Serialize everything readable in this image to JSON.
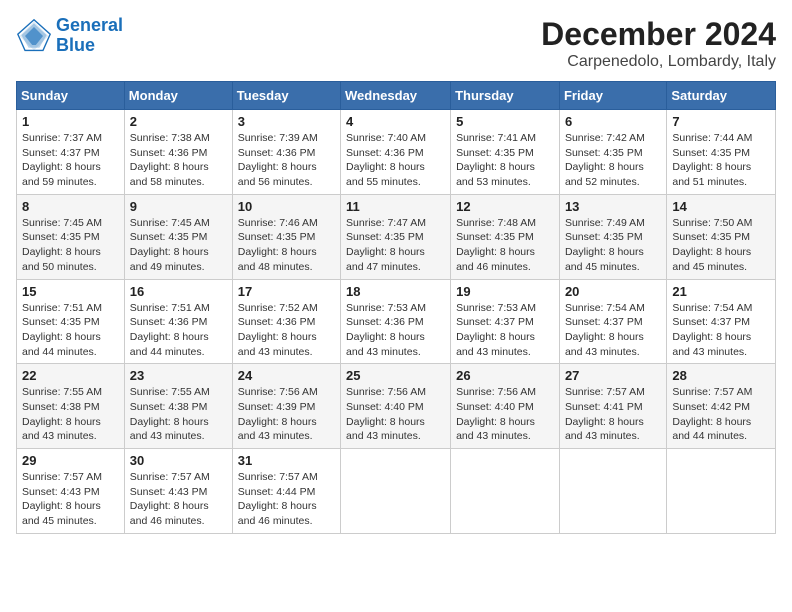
{
  "logo": {
    "line1": "General",
    "line2": "Blue"
  },
  "title": "December 2024",
  "location": "Carpenedolo, Lombardy, Italy",
  "weekdays": [
    "Sunday",
    "Monday",
    "Tuesday",
    "Wednesday",
    "Thursday",
    "Friday",
    "Saturday"
  ],
  "weeks": [
    [
      {
        "day": "1",
        "sunrise": "7:37 AM",
        "sunset": "4:37 PM",
        "daylight": "8 hours and 59 minutes."
      },
      {
        "day": "2",
        "sunrise": "7:38 AM",
        "sunset": "4:36 PM",
        "daylight": "8 hours and 58 minutes."
      },
      {
        "day": "3",
        "sunrise": "7:39 AM",
        "sunset": "4:36 PM",
        "daylight": "8 hours and 56 minutes."
      },
      {
        "day": "4",
        "sunrise": "7:40 AM",
        "sunset": "4:36 PM",
        "daylight": "8 hours and 55 minutes."
      },
      {
        "day": "5",
        "sunrise": "7:41 AM",
        "sunset": "4:35 PM",
        "daylight": "8 hours and 53 minutes."
      },
      {
        "day": "6",
        "sunrise": "7:42 AM",
        "sunset": "4:35 PM",
        "daylight": "8 hours and 52 minutes."
      },
      {
        "day": "7",
        "sunrise": "7:44 AM",
        "sunset": "4:35 PM",
        "daylight": "8 hours and 51 minutes."
      }
    ],
    [
      {
        "day": "8",
        "sunrise": "7:45 AM",
        "sunset": "4:35 PM",
        "daylight": "8 hours and 50 minutes."
      },
      {
        "day": "9",
        "sunrise": "7:45 AM",
        "sunset": "4:35 PM",
        "daylight": "8 hours and 49 minutes."
      },
      {
        "day": "10",
        "sunrise": "7:46 AM",
        "sunset": "4:35 PM",
        "daylight": "8 hours and 48 minutes."
      },
      {
        "day": "11",
        "sunrise": "7:47 AM",
        "sunset": "4:35 PM",
        "daylight": "8 hours and 47 minutes."
      },
      {
        "day": "12",
        "sunrise": "7:48 AM",
        "sunset": "4:35 PM",
        "daylight": "8 hours and 46 minutes."
      },
      {
        "day": "13",
        "sunrise": "7:49 AM",
        "sunset": "4:35 PM",
        "daylight": "8 hours and 45 minutes."
      },
      {
        "day": "14",
        "sunrise": "7:50 AM",
        "sunset": "4:35 PM",
        "daylight": "8 hours and 45 minutes."
      }
    ],
    [
      {
        "day": "15",
        "sunrise": "7:51 AM",
        "sunset": "4:35 PM",
        "daylight": "8 hours and 44 minutes."
      },
      {
        "day": "16",
        "sunrise": "7:51 AM",
        "sunset": "4:36 PM",
        "daylight": "8 hours and 44 minutes."
      },
      {
        "day": "17",
        "sunrise": "7:52 AM",
        "sunset": "4:36 PM",
        "daylight": "8 hours and 43 minutes."
      },
      {
        "day": "18",
        "sunrise": "7:53 AM",
        "sunset": "4:36 PM",
        "daylight": "8 hours and 43 minutes."
      },
      {
        "day": "19",
        "sunrise": "7:53 AM",
        "sunset": "4:37 PM",
        "daylight": "8 hours and 43 minutes."
      },
      {
        "day": "20",
        "sunrise": "7:54 AM",
        "sunset": "4:37 PM",
        "daylight": "8 hours and 43 minutes."
      },
      {
        "day": "21",
        "sunrise": "7:54 AM",
        "sunset": "4:37 PM",
        "daylight": "8 hours and 43 minutes."
      }
    ],
    [
      {
        "day": "22",
        "sunrise": "7:55 AM",
        "sunset": "4:38 PM",
        "daylight": "8 hours and 43 minutes."
      },
      {
        "day": "23",
        "sunrise": "7:55 AM",
        "sunset": "4:38 PM",
        "daylight": "8 hours and 43 minutes."
      },
      {
        "day": "24",
        "sunrise": "7:56 AM",
        "sunset": "4:39 PM",
        "daylight": "8 hours and 43 minutes."
      },
      {
        "day": "25",
        "sunrise": "7:56 AM",
        "sunset": "4:40 PM",
        "daylight": "8 hours and 43 minutes."
      },
      {
        "day": "26",
        "sunrise": "7:56 AM",
        "sunset": "4:40 PM",
        "daylight": "8 hours and 43 minutes."
      },
      {
        "day": "27",
        "sunrise": "7:57 AM",
        "sunset": "4:41 PM",
        "daylight": "8 hours and 43 minutes."
      },
      {
        "day": "28",
        "sunrise": "7:57 AM",
        "sunset": "4:42 PM",
        "daylight": "8 hours and 44 minutes."
      }
    ],
    [
      {
        "day": "29",
        "sunrise": "7:57 AM",
        "sunset": "4:43 PM",
        "daylight": "8 hours and 45 minutes."
      },
      {
        "day": "30",
        "sunrise": "7:57 AM",
        "sunset": "4:43 PM",
        "daylight": "8 hours and 46 minutes."
      },
      {
        "day": "31",
        "sunrise": "7:57 AM",
        "sunset": "4:44 PM",
        "daylight": "8 hours and 46 minutes."
      },
      null,
      null,
      null,
      null
    ]
  ]
}
